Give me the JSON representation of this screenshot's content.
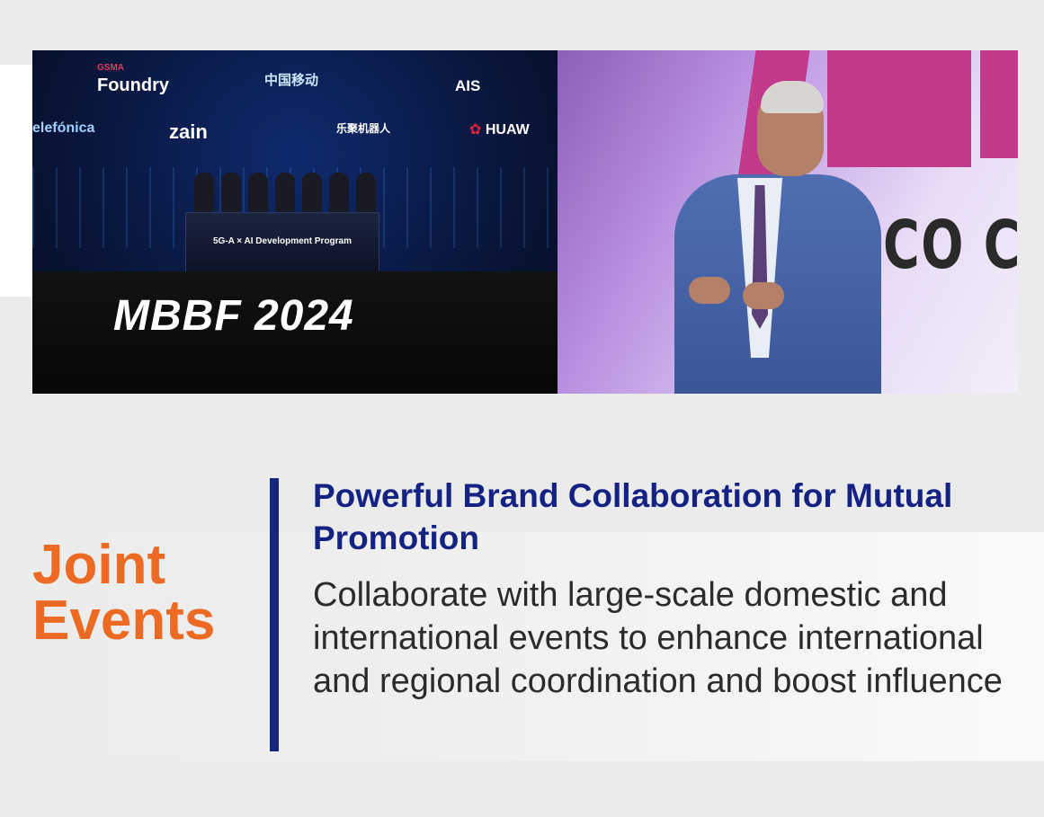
{
  "photo_left": {
    "logos": {
      "gsma": "GSMA",
      "foundry": "Foundry",
      "china_mobile": "中国移动",
      "ais": "AIS",
      "telefonica": "elefónica",
      "zain": "zain",
      "ucai": "乐聚机器人",
      "huawei": "HUAW"
    },
    "screen_text": "5G-A × AI Development Program",
    "event_name": "MBBF 2024"
  },
  "photo_right": {
    "sign_text": "CO CIT"
  },
  "section": {
    "title_line1": "Joint",
    "title_line2": "Events",
    "heading": "Powerful Brand Collaboration for Mutual Promotion",
    "body": "Collaborate with large-scale domestic and international events to enhance international and regional coordination and boost influence"
  },
  "colors": {
    "title": "#ec6a23",
    "heading": "#142284",
    "divider": "#16267a"
  }
}
